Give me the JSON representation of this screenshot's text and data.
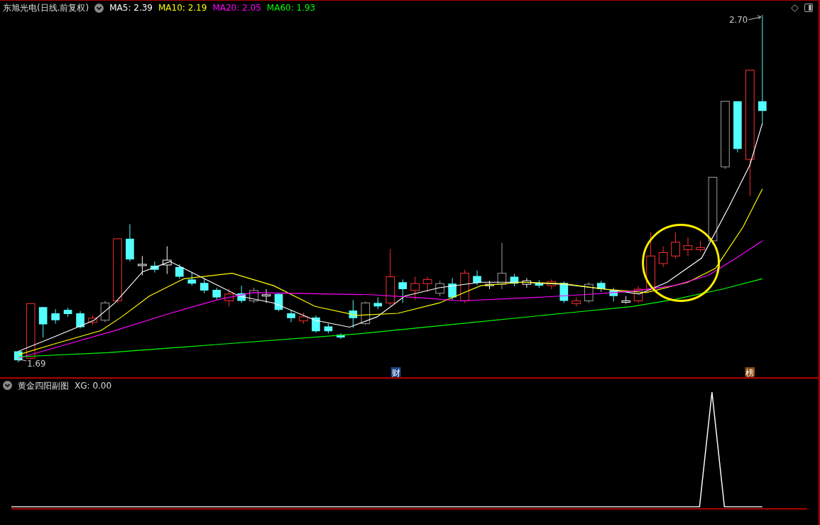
{
  "main_chart": {
    "title": "东旭光电(日线.前复权)",
    "indicators": [
      {
        "label": "MA5: 2.39",
        "color": "#ffffff"
      },
      {
        "label": "MA10: 2.19",
        "color": "#ffff00"
      },
      {
        "label": "MA20: 2.05",
        "color": "#ff00ff"
      },
      {
        "label": "MA60: 1.93",
        "color": "#00ff00"
      }
    ],
    "high_label": "2.70",
    "low_label": "1.69",
    "markers": [
      {
        "text": "财",
        "color": "#1c4a8a"
      },
      {
        "text": "榜",
        "color": "#8a4a10"
      }
    ]
  },
  "sub_chart": {
    "title": "黄金四阳副图",
    "reading": "XG: 0.00"
  }
}
